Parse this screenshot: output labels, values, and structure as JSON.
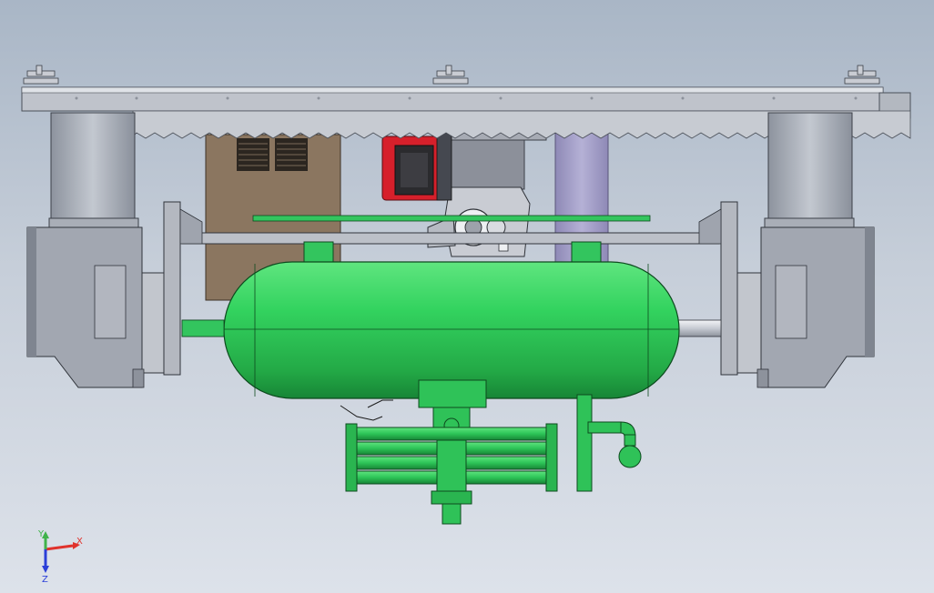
{
  "viewport": {
    "background_top": "#a9b6c6",
    "background_bottom": "#dde2ea"
  },
  "colors": {
    "tank_green": "#2fd15c",
    "tank_green_dark": "#1f9a40",
    "tank_outline": "#0d4a1e",
    "steel": "#b9bec8",
    "steel_dark": "#7e8592",
    "brown_panel": "#8b7660",
    "motor_red": "#d6202b",
    "purple_column": "#a39fc6"
  },
  "axis_triad": {
    "x_label": "X",
    "y_label": "Y",
    "z_label": "Z",
    "x_color": "#e0322c",
    "y_color": "#3fb34a",
    "z_color": "#2b3fd8"
  },
  "parts": [
    "top-rail-beam",
    "left-column",
    "right-column",
    "left-gearbox",
    "right-gearbox",
    "brown-cabinet",
    "red-motor",
    "purple-column",
    "horizontal-tank",
    "lower-cylinder-assembly",
    "drain-pipe"
  ]
}
